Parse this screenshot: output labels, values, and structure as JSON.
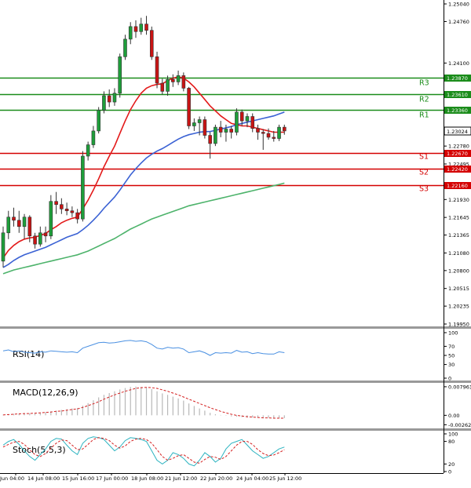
{
  "chart_data": {
    "type": "candlestick",
    "price_axis": {
      "ticks": [
        "1.25040",
        "1.24760",
        "1.24100",
        "1.23870",
        "1.23610",
        "1.23360",
        "1.23024",
        "1.22780",
        "1.22670",
        "1.22495",
        "1.22420",
        "1.22160",
        "1.21930",
        "1.21645",
        "1.21365",
        "1.21080",
        "1.20800",
        "1.20515",
        "1.20235",
        "1.19950"
      ],
      "range": [
        1.1995,
        1.2504
      ]
    },
    "levels": [
      {
        "name": "R3",
        "value": "1.23870",
        "color": "#1a8c1a"
      },
      {
        "name": "R2",
        "value": "1.23610",
        "color": "#1a8c1a"
      },
      {
        "name": "R1",
        "value": "1.23360",
        "color": "#1a8c1a"
      },
      {
        "name": "S1",
        "value": "1.22670",
        "color": "#d40000"
      },
      {
        "name": "S2",
        "value": "1.22420",
        "color": "#d40000"
      },
      {
        "name": "S3",
        "value": "1.22160",
        "color": "#d40000"
      }
    ],
    "current_price": "1.23024",
    "time_axis": [
      "Jun 04:00",
      "14 Jun 08:00",
      "15 Jun 16:00",
      "17 Jun 00:00",
      "18 Jun 08:00",
      "21 Jun 12:00",
      "22 Jun 20:00",
      "24 Jun 04:00",
      "25 Jun 12:00"
    ],
    "candles": [
      [
        1.2095,
        1.215,
        1.2085,
        1.214
      ],
      [
        1.214,
        1.2175,
        1.213,
        1.2165
      ],
      [
        1.2165,
        1.218,
        1.215,
        1.216
      ],
      [
        1.216,
        1.2175,
        1.214,
        1.215
      ],
      [
        1.215,
        1.217,
        1.213,
        1.2165
      ],
      [
        1.2165,
        1.2168,
        1.2125,
        1.2135
      ],
      [
        1.2135,
        1.214,
        1.2115,
        1.2122
      ],
      [
        1.2122,
        1.215,
        1.2118,
        1.214
      ],
      [
        1.214,
        1.215,
        1.2125,
        1.2135
      ],
      [
        1.2135,
        1.22,
        1.213,
        1.219
      ],
      [
        1.219,
        1.2205,
        1.217,
        1.2185
      ],
      [
        1.2185,
        1.2195,
        1.217,
        1.2178
      ],
      [
        1.2178,
        1.2188,
        1.2168,
        1.2175
      ],
      [
        1.2175,
        1.2182,
        1.2165,
        1.2172
      ],
      [
        1.2172,
        1.2178,
        1.2155,
        1.2162
      ],
      [
        1.2162,
        1.227,
        1.2158,
        1.2262
      ],
      [
        1.2262,
        1.2285,
        1.2255,
        1.228
      ],
      [
        1.228,
        1.231,
        1.2275,
        1.2302
      ],
      [
        1.2302,
        1.234,
        1.2298,
        1.2335
      ],
      [
        1.2335,
        1.2365,
        1.233,
        1.2358
      ],
      [
        1.2358,
        1.2368,
        1.234,
        1.2348
      ],
      [
        1.2348,
        1.237,
        1.2342,
        1.2362
      ],
      [
        1.2362,
        1.2425,
        1.2355,
        1.242
      ],
      [
        1.242,
        1.2455,
        1.2415,
        1.2448
      ],
      [
        1.2448,
        1.2475,
        1.244,
        1.2468
      ],
      [
        1.2468,
        1.2478,
        1.245,
        1.246
      ],
      [
        1.246,
        1.2482,
        1.2455,
        1.2472
      ],
      [
        1.2472,
        1.2485,
        1.2455,
        1.2462
      ],
      [
        1.2462,
        1.2468,
        1.2415,
        1.242
      ],
      [
        1.242,
        1.2428,
        1.237,
        1.2378
      ],
      [
        1.2378,
        1.2385,
        1.236,
        1.2365
      ],
      [
        1.2365,
        1.239,
        1.2358,
        1.2384
      ],
      [
        1.2384,
        1.2392,
        1.2372,
        1.238
      ],
      [
        1.238,
        1.2398,
        1.2375,
        1.239
      ],
      [
        1.239,
        1.2395,
        1.2365,
        1.237
      ],
      [
        1.237,
        1.2372,
        1.2305,
        1.231
      ],
      [
        1.231,
        1.2322,
        1.2302,
        1.2315
      ],
      [
        1.2315,
        1.2325,
        1.2295,
        1.232
      ],
      [
        1.232,
        1.2325,
        1.229,
        1.2295
      ],
      [
        1.2295,
        1.23,
        1.2258,
        1.2282
      ],
      [
        1.2282,
        1.2312,
        1.2278,
        1.2308
      ],
      [
        1.2308,
        1.2318,
        1.2292,
        1.23
      ],
      [
        1.23,
        1.2312,
        1.2285,
        1.2305
      ],
      [
        1.2305,
        1.231,
        1.229,
        1.23
      ],
      [
        1.23,
        1.2338,
        1.2295,
        1.2332
      ],
      [
        1.2332,
        1.2336,
        1.231,
        1.2318
      ],
      [
        1.2318,
        1.233,
        1.2308,
        1.2325
      ],
      [
        1.2325,
        1.233,
        1.23,
        1.2306
      ],
      [
        1.2306,
        1.2312,
        1.2288,
        1.23
      ],
      [
        1.23,
        1.2305,
        1.2272,
        1.2298
      ],
      [
        1.2298,
        1.2306,
        1.2288,
        1.2292
      ],
      [
        1.2292,
        1.2302,
        1.2285,
        1.229
      ],
      [
        1.229,
        1.2312,
        1.2286,
        1.2308
      ],
      [
        1.2308,
        1.2312,
        1.2296,
        1.2302
      ]
    ],
    "ma_red": [
      1.21,
      1.2112,
      1.212,
      1.2126,
      1.213,
      1.2132,
      1.2133,
      1.2136,
      1.2139,
      1.2145,
      1.215,
      1.2156,
      1.216,
      1.2163,
      1.2165,
      1.2178,
      1.2192,
      1.2208,
      1.2226,
      1.2245,
      1.2262,
      1.2278,
      1.2298,
      1.2318,
      1.2336,
      1.235,
      1.2362,
      1.237,
      1.2374,
      1.2376,
      1.2377,
      1.2382,
      1.2386,
      1.2388,
      1.2386,
      1.238,
      1.2372,
      1.2362,
      1.2352,
      1.2342,
      1.2334,
      1.2326,
      1.232,
      1.2314,
      1.2312,
      1.231,
      1.231,
      1.2308,
      1.2306,
      1.2304,
      1.2302,
      1.23,
      1.23,
      1.23
    ],
    "ma_blue": [
      1.2085,
      1.209,
      1.2096,
      1.2101,
      1.2105,
      1.2108,
      1.2111,
      1.2114,
      1.2117,
      1.2121,
      1.2125,
      1.2129,
      1.2133,
      1.2136,
      1.2139,
      1.2145,
      1.2152,
      1.216,
      1.2169,
      1.2179,
      1.2188,
      1.2197,
      1.2208,
      1.222,
      1.2232,
      1.2242,
      1.2251,
      1.2259,
      1.2265,
      1.227,
      1.2274,
      1.2279,
      1.2284,
      1.2289,
      1.2293,
      1.2296,
      1.2298,
      1.23,
      1.2301,
      1.2301,
      1.2303,
      1.2305,
      1.2307,
      1.2309,
      1.2312,
      1.2314,
      1.2316,
      1.2318,
      1.232,
      1.2322,
      1.2324,
      1.2326,
      1.2329,
      1.2332
    ],
    "ma_green": [
      1.2075,
      1.2078,
      1.2081,
      1.2083,
      1.2085,
      1.2087,
      1.2089,
      1.2091,
      1.2093,
      1.2095,
      1.2097,
      1.2099,
      1.2101,
      1.2103,
      1.2105,
      1.2108,
      1.2111,
      1.2115,
      1.2119,
      1.2123,
      1.2127,
      1.2131,
      1.2136,
      1.2141,
      1.2146,
      1.215,
      1.2154,
      1.2158,
      1.2162,
      1.2165,
      1.2168,
      1.2171,
      1.2174,
      1.2177,
      1.218,
      1.2183,
      1.2185,
      1.2187,
      1.2189,
      1.2191,
      1.2193,
      1.2195,
      1.2197,
      1.2199,
      1.2201,
      1.2203,
      1.2205,
      1.2207,
      1.2209,
      1.2211,
      1.2213,
      1.2215,
      1.2217,
      1.2219
    ],
    "rsi": {
      "label": "RSI(14)",
      "ticks": [
        "100",
        "70",
        "50",
        "30",
        "0"
      ],
      "values": [
        60,
        62,
        58,
        60,
        57,
        56,
        55,
        58,
        57,
        60,
        59,
        58,
        57,
        58,
        56,
        66,
        70,
        74,
        78,
        79,
        77,
        78,
        80,
        82,
        83,
        81,
        82,
        80,
        74,
        66,
        64,
        68,
        66,
        67,
        64,
        56,
        58,
        60,
        56,
        50,
        56,
        55,
        56,
        55,
        61,
        57,
        58,
        54,
        56,
        54,
        53,
        53,
        58,
        56
      ]
    },
    "macd": {
      "label": "MACD(12,26,9)",
      "ticks": [
        "0.007961",
        "0.00",
        "-0.002625"
      ],
      "range": [
        -0.0032,
        0.0086
      ],
      "histogram": [
        0.0002,
        0.0003,
        0.0004,
        0.0005,
        0.0006,
        0.0006,
        0.0007,
        0.0008,
        0.0009,
        0.0011,
        0.0013,
        0.0015,
        0.0017,
        0.0019,
        0.002,
        0.0027,
        0.0034,
        0.0042,
        0.005,
        0.0057,
        0.0062,
        0.0067,
        0.0072,
        0.0076,
        0.0079,
        0.008,
        0.0079,
        0.0077,
        0.0073,
        0.0067,
        0.0061,
        0.0057,
        0.0052,
        0.0047,
        0.0041,
        0.0033,
        0.0026,
        0.0019,
        0.0013,
        0.0007,
        0.0003,
        0.0001,
        -0.0001,
        -0.0003,
        -0.0004,
        -0.0005,
        -0.0006,
        -0.0006,
        -0.0007,
        -0.0007,
        -0.0007,
        -0.0008,
        -0.0008,
        -0.0008
      ],
      "signal": [
        0.0001,
        0.0002,
        0.0003,
        0.0004,
        0.0005,
        0.0005,
        0.0006,
        0.0007,
        0.0008,
        0.0009,
        0.0011,
        0.0012,
        0.0014,
        0.0016,
        0.0018,
        0.0022,
        0.0027,
        0.0032,
        0.0038,
        0.0045,
        0.0051,
        0.0057,
        0.0062,
        0.0067,
        0.0071,
        0.0075,
        0.0077,
        0.0078,
        0.0077,
        0.0075,
        0.0071,
        0.0067,
        0.0062,
        0.0057,
        0.0051,
        0.0045,
        0.0039,
        0.0033,
        0.0027,
        0.0021,
        0.0016,
        0.0011,
        0.0007,
        0.0003,
        0.0,
        -0.0002,
        -0.0004,
        -0.0005,
        -0.0006,
        -0.0007,
        -0.0007,
        -0.0008,
        -0.0008,
        -0.0008
      ]
    },
    "stoch": {
      "label": "Stoch(5,5,3)",
      "ticks": [
        "100",
        "80",
        "20",
        "0"
      ],
      "k": [
        70,
        80,
        85,
        72,
        55,
        40,
        30,
        45,
        60,
        80,
        88,
        86,
        70,
        55,
        45,
        75,
        88,
        92,
        90,
        85,
        70,
        55,
        65,
        82,
        90,
        88,
        85,
        80,
        55,
        30,
        20,
        30,
        50,
        45,
        35,
        20,
        15,
        30,
        50,
        40,
        25,
        35,
        60,
        75,
        80,
        85,
        70,
        55,
        45,
        35,
        40,
        50,
        60,
        65
      ],
      "d": [
        65,
        72,
        78,
        80,
        72,
        58,
        45,
        40,
        48,
        62,
        75,
        84,
        82,
        70,
        58,
        60,
        72,
        85,
        90,
        88,
        82,
        70,
        62,
        68,
        80,
        86,
        88,
        85,
        75,
        58,
        40,
        30,
        35,
        42,
        45,
        35,
        25,
        22,
        32,
        40,
        38,
        32,
        40,
        55,
        70,
        80,
        80,
        72,
        58,
        48,
        42,
        44,
        50,
        58
      ]
    }
  }
}
